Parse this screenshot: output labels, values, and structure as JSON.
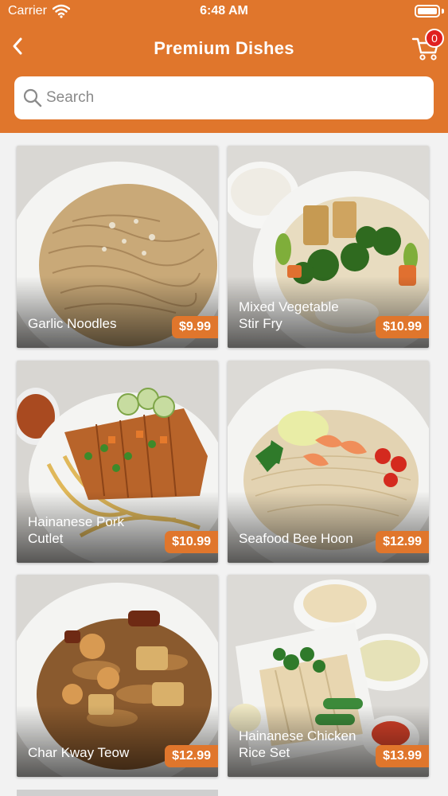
{
  "status_bar": {
    "carrier": "Carrier",
    "time": "6:48 AM"
  },
  "header": {
    "title": "Premium Dishes",
    "cart_count": "0"
  },
  "search": {
    "placeholder": "Search"
  },
  "dishes": [
    {
      "name": "Garlic Noodles",
      "price": "$9.99"
    },
    {
      "name": "Mixed Vegetable Stir Fry",
      "price": "$10.99"
    },
    {
      "name": "Hainanese Pork Cutlet",
      "price": "$10.99"
    },
    {
      "name": "Seafood Bee Hoon",
      "price": "$12.99"
    },
    {
      "name": "Char Kway Teow",
      "price": "$12.99"
    },
    {
      "name": "Hainanese Chicken Rice Set",
      "price": "$13.99"
    }
  ],
  "colors": {
    "accent": "#e0762c",
    "badge": "#e02020"
  }
}
